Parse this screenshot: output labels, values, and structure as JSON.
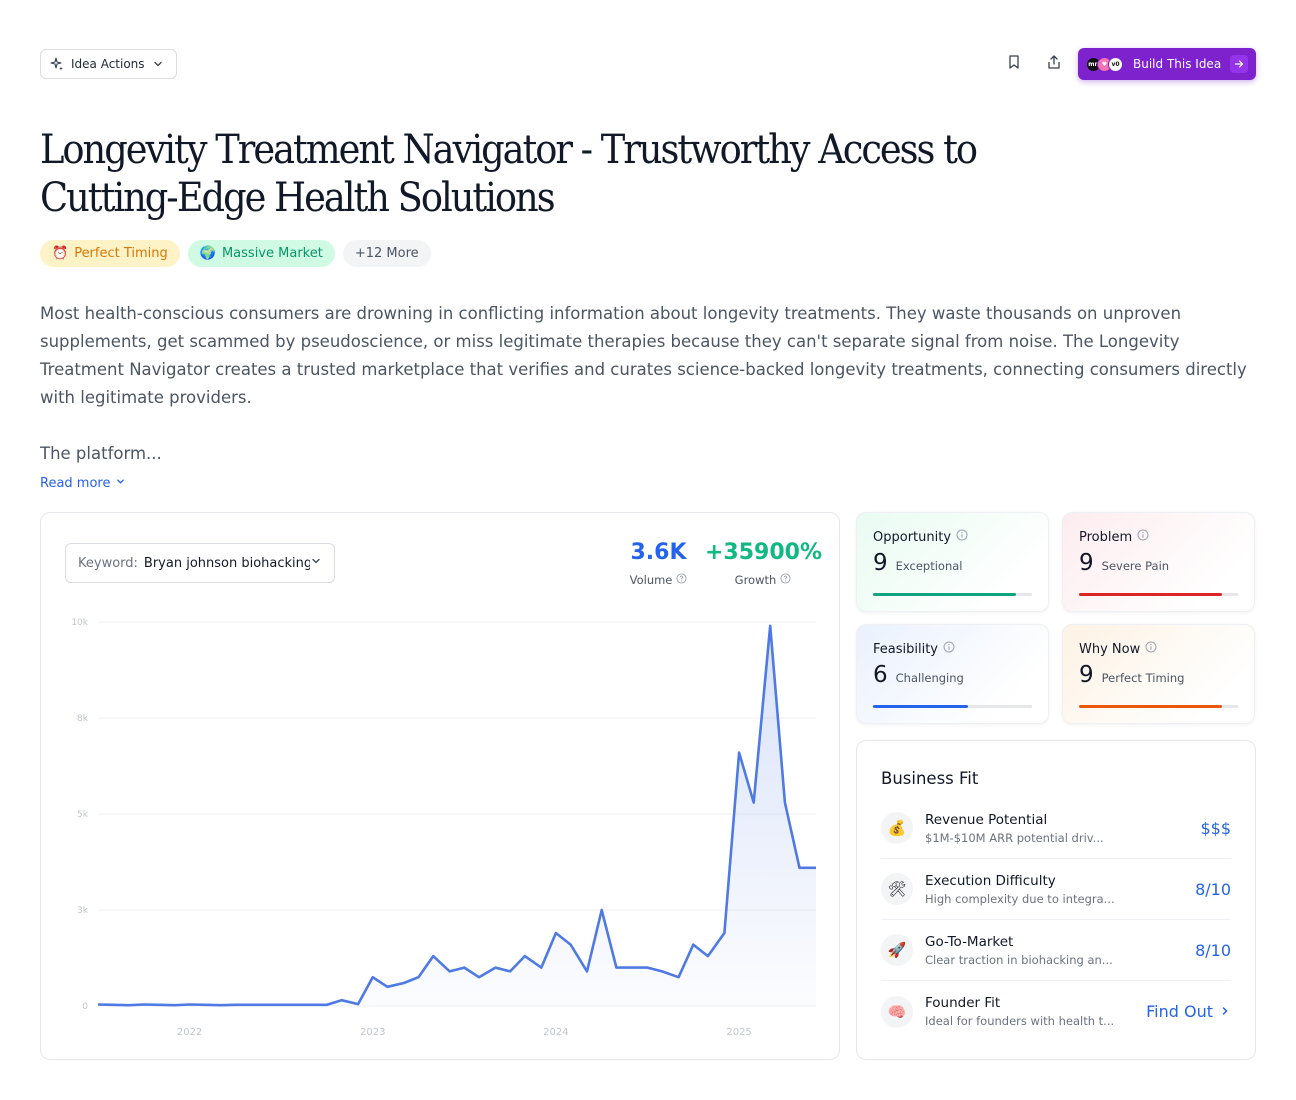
{
  "toolbar": {
    "idea_actions_label": "Idea Actions",
    "build_label": "Build This Idea",
    "build_logos": [
      "mn",
      "♥",
      "v0"
    ]
  },
  "title": "Longevity Treatment Navigator - Trustworthy Access to Cutting-Edge Health Solutions",
  "tags": [
    {
      "icon": "⏰",
      "label": "Perfect Timing"
    },
    {
      "icon": "🌍",
      "label": "Massive Market"
    },
    {
      "label": "+12 More"
    }
  ],
  "description": {
    "paragraph1": "Most health-conscious consumers are drowning in conflicting information about longevity treatments. They waste thousands on unproven supplements, get scammed by pseudoscience, or miss legitimate therapies because they can't separate signal from noise. The Longevity Treatment Navigator creates a trusted marketplace that verifies and curates science-backed longevity treatments, connecting consumers directly with legitimate providers.",
    "paragraph2": "The platform...",
    "read_more": "Read more"
  },
  "keyword": {
    "label": "Keyword:",
    "value": "Bryan johnson biohacking"
  },
  "metrics": {
    "volume": {
      "value": "3.6K",
      "label": "Volume"
    },
    "growth": {
      "value": "+35900%",
      "label": "Growth"
    }
  },
  "chart_data": {
    "type": "area",
    "y_ticks": [
      "0",
      "3k",
      "5k",
      "8k",
      "10k"
    ],
    "ylim": [
      0,
      10000
    ],
    "x_ticks": [
      "2022",
      "2023",
      "2024",
      "2025"
    ],
    "x_tick_positions": [
      2022,
      2023,
      2024,
      2025
    ],
    "xlim": [
      2021.5,
      2025.42
    ],
    "x": [
      2021.5,
      2021.58,
      2021.67,
      2021.75,
      2021.83,
      2021.92,
      2022.0,
      2022.08,
      2022.17,
      2022.25,
      2022.33,
      2022.42,
      2022.5,
      2022.58,
      2022.67,
      2022.75,
      2022.83,
      2022.92,
      2023.0,
      2023.08,
      2023.17,
      2023.25,
      2023.33,
      2023.42,
      2023.5,
      2023.58,
      2023.67,
      2023.75,
      2023.83,
      2023.92,
      2024.0,
      2024.08,
      2024.17,
      2024.25,
      2024.33,
      2024.42,
      2024.5,
      2024.58,
      2024.67,
      2024.75,
      2024.83,
      2024.92,
      2025.0,
      2025.08,
      2025.17,
      2025.25,
      2025.33,
      2025.42
    ],
    "values": [
      40,
      30,
      20,
      40,
      30,
      20,
      40,
      30,
      20,
      30,
      30,
      30,
      30,
      30,
      30,
      30,
      150,
      50,
      750,
      500,
      600,
      750,
      1300,
      900,
      1000,
      750,
      1000,
      900,
      1300,
      1000,
      1900,
      1600,
      900,
      2500,
      1000,
      1000,
      1000,
      900,
      750,
      1600,
      1300,
      1900,
      6600,
      5300,
      9900,
      5300,
      3600,
      3600
    ],
    "series_color": "#4f7ae3"
  },
  "scores": [
    {
      "key": "opp",
      "title": "Opportunity",
      "value": "9",
      "label": "Exceptional",
      "fill": 0.9,
      "color": "#10a37f"
    },
    {
      "key": "pro",
      "title": "Problem",
      "value": "9",
      "label": "Severe Pain",
      "fill": 0.9,
      "color": "#dc2626"
    },
    {
      "key": "fea",
      "title": "Feasibility",
      "value": "6",
      "label": "Challenging",
      "fill": 0.6,
      "color": "#2563eb"
    },
    {
      "key": "why",
      "title": "Why Now",
      "value": "9",
      "label": "Perfect Timing",
      "fill": 0.9,
      "color": "#ea580c"
    }
  ],
  "business_fit": {
    "title": "Business Fit",
    "items": [
      {
        "icon": "💰",
        "title": "Revenue Potential",
        "desc": "$1M-$10M ARR potential driv...",
        "value": "$$$"
      },
      {
        "icon": "🛠",
        "title": "Execution Difficulty",
        "desc": "High complexity due to integra...",
        "value": "8/10"
      },
      {
        "icon": "🚀",
        "title": "Go-To-Market",
        "desc": "Clear traction in biohacking an...",
        "value": "8/10"
      },
      {
        "icon": "🧠",
        "title": "Founder Fit",
        "desc": "Ideal for founders with health t...",
        "value": "Find Out"
      }
    ]
  }
}
